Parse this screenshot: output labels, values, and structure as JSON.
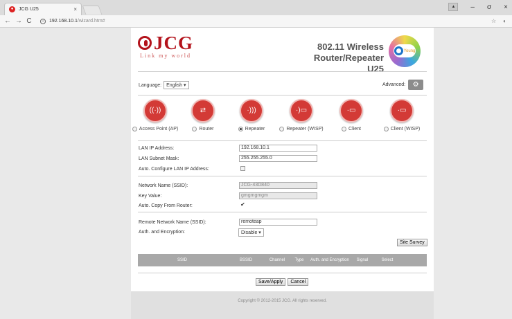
{
  "browser": {
    "tab_title": "JCG U25",
    "tab_close": "×",
    "back": "←",
    "forward": "→",
    "reload": "C",
    "url_host": "192.168.10.1",
    "url_path": "/wizard.htm#",
    "win_min": "–",
    "win_max": "σ",
    "win_close": "×"
  },
  "header": {
    "brand": "JCG",
    "slogan": "Link my world",
    "model_line1": "802.11 Wireless Router/Repeater",
    "model_line2": "U25",
    "badge": "Young"
  },
  "language": {
    "label": "Language:",
    "value": "English"
  },
  "advanced_label": "Advanced:",
  "modes": [
    {
      "label": "Access Point (AP)",
      "selected": false
    },
    {
      "label": "Router",
      "selected": false
    },
    {
      "label": "Repeater",
      "selected": true
    },
    {
      "label": "Repeater (WISP)",
      "selected": false
    },
    {
      "label": "Client",
      "selected": false
    },
    {
      "label": "Client (WISP)",
      "selected": false
    }
  ],
  "lan": {
    "ip_label": "LAN IP Address:",
    "ip_value": "192.168.10.1",
    "mask_label": "LAN Subnet Mask:",
    "mask_value": "255.255.255.0",
    "auto_label": "Auto. Configure LAN IP Address:"
  },
  "wireless": {
    "ssid_label": "Network Name (SSID):",
    "ssid_value": "JCG-43D840",
    "key_label": "Key Value:",
    "key_value": "gmgmgmgm",
    "copy_label": "Auto. Copy From Router:"
  },
  "remote": {
    "ssid_label": "Remote Network Name (SSID):",
    "ssid_value": "remoteap",
    "auth_label": "Auth. and Encryption:",
    "auth_value": "Disable"
  },
  "site_survey_label": "Site Survey",
  "table_headers": [
    "SSID",
    "BSSID",
    "Channel",
    "Type",
    "Auth. and Encryption",
    "Signal",
    "Select"
  ],
  "buttons": {
    "save": "Save/Apply",
    "cancel": "Cancel"
  },
  "footer": "Copyright © 2012-2015 JCG. All rights reserved."
}
